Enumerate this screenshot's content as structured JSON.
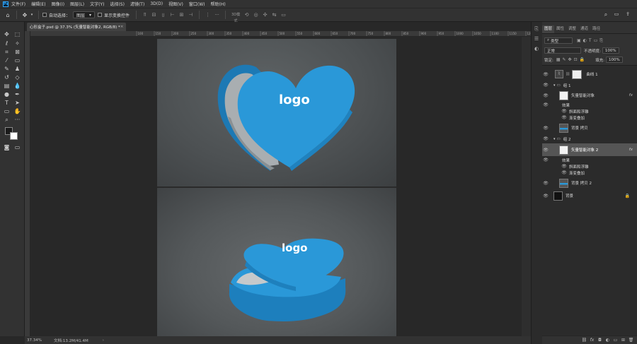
{
  "app": {
    "logo_text": "Ps"
  },
  "menu": [
    "文件(F)",
    "编辑(E)",
    "图像(I)",
    "图层(L)",
    "文字(Y)",
    "选择(S)",
    "滤镜(T)",
    "3D(D)",
    "视图(V)",
    "窗口(W)",
    "帮助(H)"
  ],
  "options": {
    "auto_select_label": "自动选择：",
    "auto_select_value": "图层",
    "show_transform_label": "显示变换控件"
  },
  "document_tab": {
    "title": "心形盒子.psd @ 37.3% (矢量智能对象2, RGB/8) *",
    "close": "×"
  },
  "ruler_ticks": [
    "100",
    "150",
    "200",
    "250",
    "300",
    "350",
    "400",
    "450",
    "500",
    "550",
    "600",
    "650",
    "700",
    "750",
    "800",
    "850",
    "900",
    "950",
    "1000",
    "1050",
    "1100",
    "1150",
    "1200",
    "1250",
    "1300",
    "1350",
    "1400",
    "1450"
  ],
  "canvas": {
    "logo_top": "logo",
    "logo_bottom": "logo"
  },
  "status": {
    "zoom": "37.34%",
    "doc_size": "文档:13.2M/41.4M",
    "arrow": "›"
  },
  "panel": {
    "tabs": [
      "图层",
      "属性",
      "调整",
      "通道",
      "路径"
    ],
    "kind_filter": "类型",
    "blend_mode": "正常",
    "opacity_label": "不透明度:",
    "opacity_value": "100%",
    "lock_label": "锁定:",
    "fill_label": "填充:",
    "fill_value": "100%",
    "layers": [
      {
        "name": "曲线 1"
      },
      {
        "name": "组 1"
      },
      {
        "name": "矢量智能对象",
        "fx": "fx"
      },
      {
        "name": "效果"
      },
      {
        "name": "斜面和浮雕"
      },
      {
        "name": "渐变叠加"
      },
      {
        "name": "背景 拷贝"
      },
      {
        "name": "组 2"
      },
      {
        "name": "矢量智能对象 2",
        "fx": "fx"
      },
      {
        "name": "效果"
      },
      {
        "name": "斜面和浮雕"
      },
      {
        "name": "渐变叠加"
      },
      {
        "name": "背景 拷贝 2"
      },
      {
        "name": "背景"
      }
    ]
  },
  "colors": {
    "box_blue": "#2a98d8",
    "box_blue_dark": "#1d79b4",
    "canvas_bg": "#282828",
    "panel_bg": "#323232"
  }
}
